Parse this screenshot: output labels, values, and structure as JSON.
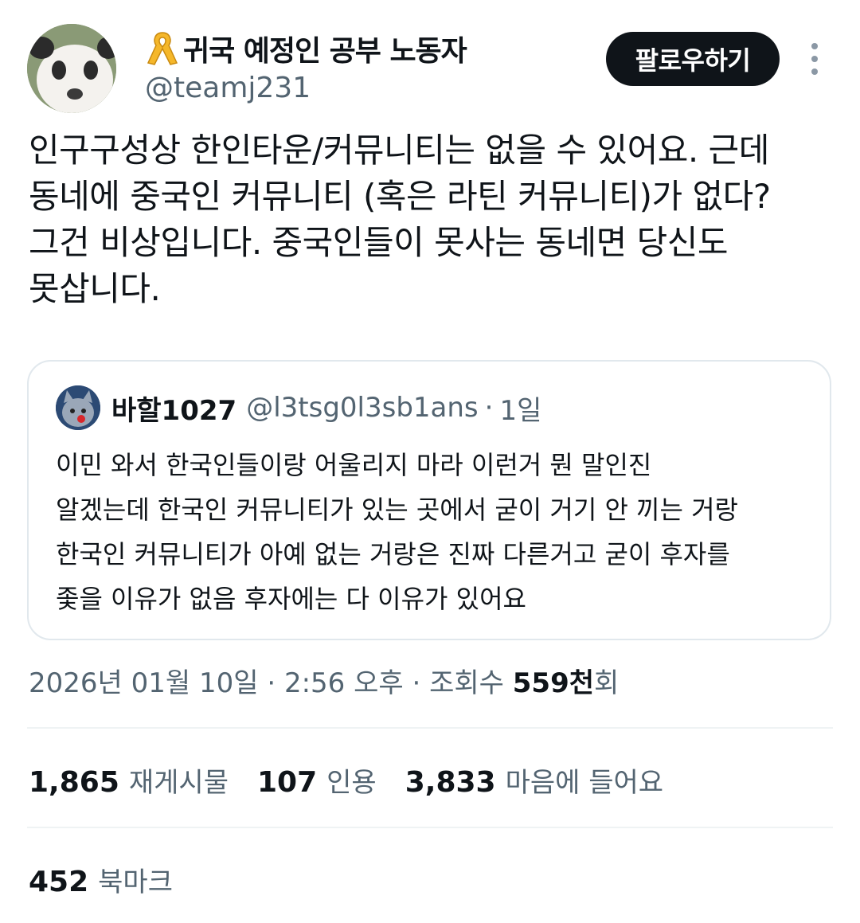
{
  "author": {
    "display_name": "귀국 예정인 공부 노동자",
    "handle": "@teamj231",
    "badge_icon": "yellow-ribbon-icon",
    "avatar_icon": "panda-avatar"
  },
  "follow_button": {
    "label": "팔로우하기"
  },
  "more_icon": "more-vertical-icon",
  "tweet": {
    "text": "인구구성상 한인타운/커뮤니티는 없을 수 있어요. 근데\n동네에 중국인 커뮤니티 (혹은 라틴 커뮤니티)가 없다?\n그건 비상입니다. 중국인들이 못사는 동네면 당신도\n못삽니다."
  },
  "quote": {
    "name": "바할1027",
    "handle": "@l3tsg0l3sb1ans",
    "separator": "·",
    "time": "1일",
    "text": "이민 와서 한국인들이랑 어울리지 마라 이런거 뭔 말인진\n알겠는데 한국인 커뮤니티가 있는 곳에서 굳이 거기 안 끼는 거랑\n한국인 커뮤니티가 아예 없는 거랑은 진짜 다른거고 굳이 후자를\n좇을 이유가 없음 후자에는 다 이유가 있어요"
  },
  "meta": {
    "date": "2026년 01월 10일",
    "sep1": " · ",
    "time": "2:56 오후",
    "sep2": " · ",
    "views_label": "조회수 ",
    "views_value": "559천",
    "views_suffix": "회"
  },
  "stats": {
    "reposts_value": "1,865",
    "reposts_label": "재게시물",
    "quotes_value": "107",
    "quotes_label": "인용",
    "likes_value": "3,833",
    "likes_label": "마음에 들어요",
    "bookmarks_value": "452",
    "bookmarks_label": "북마크"
  },
  "colors": {
    "text": "#0f1419",
    "secondary": "#536471",
    "border": "#e1e8ed",
    "follow_bg": "#0f1419",
    "ribbon": "#f5b72a"
  }
}
